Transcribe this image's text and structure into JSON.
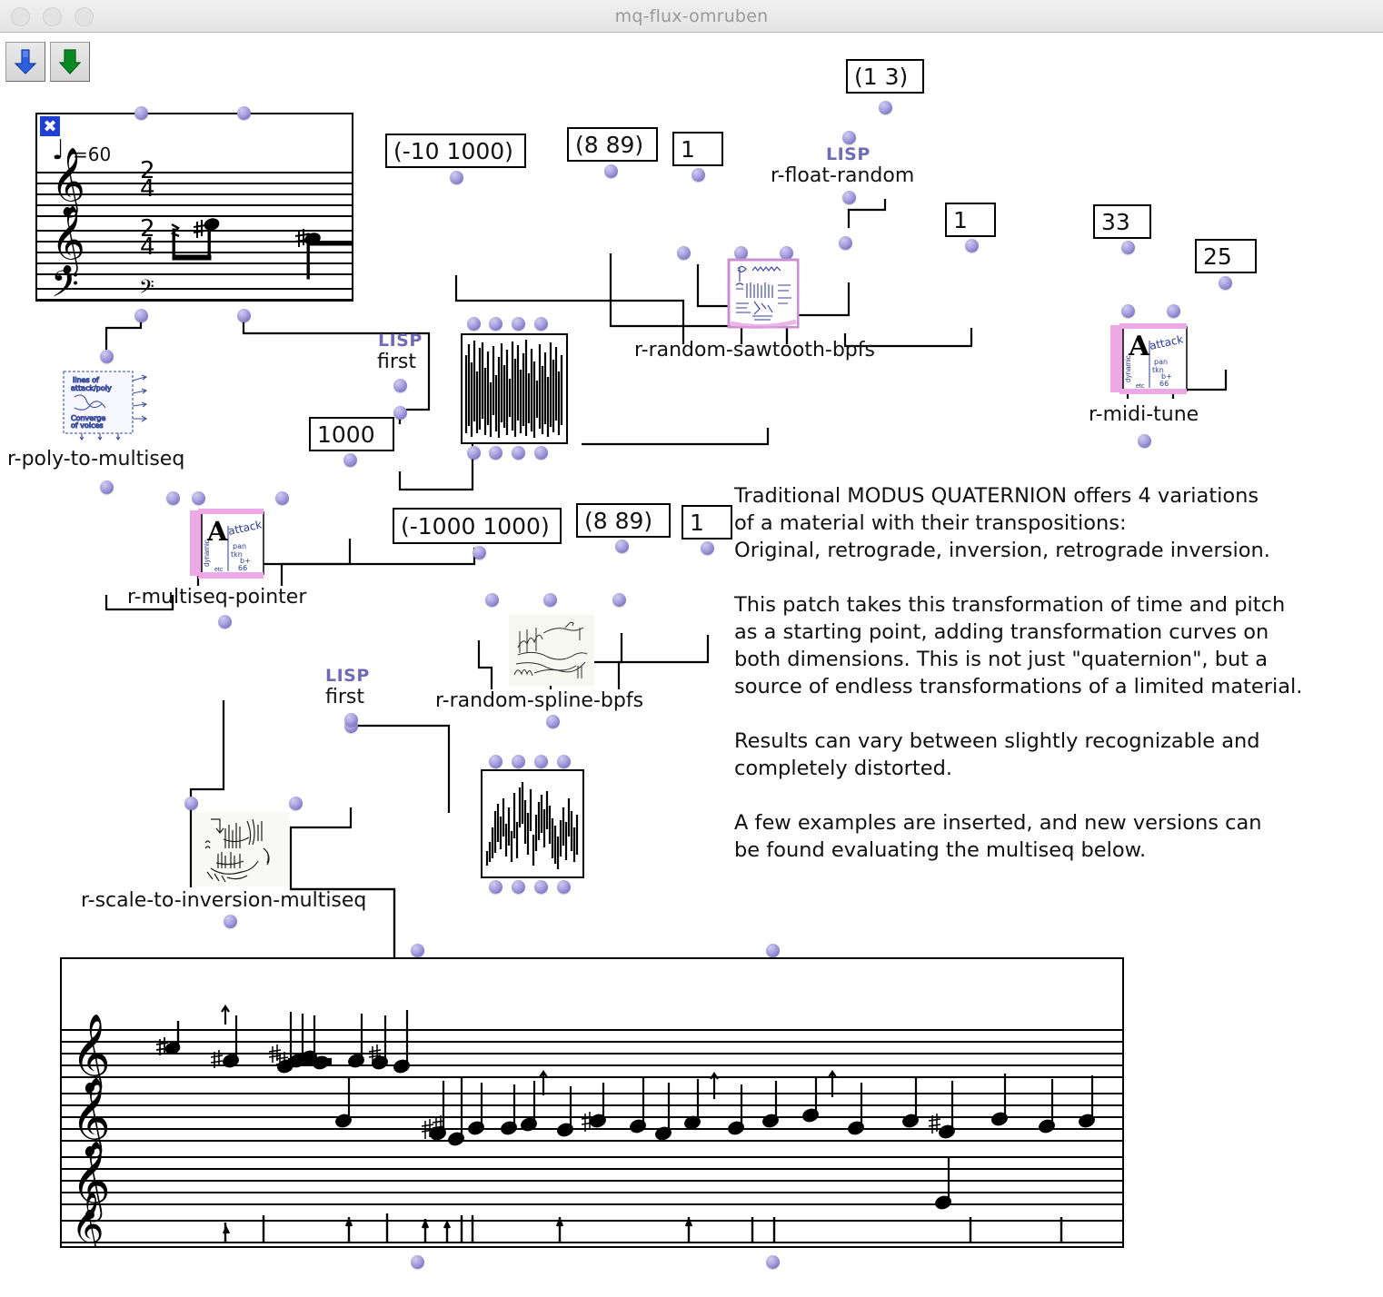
{
  "window": {
    "title": "mq-flux-omruben",
    "traffic_lights": [
      "close",
      "minimize",
      "zoom"
    ]
  },
  "toolbar": {
    "buttons": [
      {
        "name": "eval-down-blue",
        "icon": "down-arrow-blue-icon",
        "color": "#2b5fe0"
      },
      {
        "name": "eval-down-green",
        "icon": "down-arrow-green-icon",
        "color": "#0a8a22"
      }
    ]
  },
  "boxes": {
    "b_neg10_1000": "(-10 1000)",
    "b_8_89_top": "(8 89)",
    "b_1_top": "1",
    "b_1_3": "(1 3)",
    "b_1_right": "1",
    "b_33": "33",
    "b_25": "25",
    "b_1000": "1000",
    "b_neg1000_1000": "(-1000 1000)",
    "b_8_89_bottom": "(8 89)",
    "b_1_bottom": "1"
  },
  "nodes": {
    "float_random": {
      "lisp": "LISP",
      "label": "r-float-random"
    },
    "sawtooth": {
      "label": "r-random-sawtooth-bpfs"
    },
    "midi_tune": {
      "label": "r-midi-tune"
    },
    "poly_to_multiseq": {
      "label": "r-poly-to-multiseq"
    },
    "first_top": {
      "lisp": "LISP",
      "label": "first"
    },
    "multiseq_pointer": {
      "label": "r-multiseq-pointer"
    },
    "spline": {
      "label": "r-random-spline-bpfs"
    },
    "first_bottom": {
      "lisp": "LISP",
      "label": "first"
    },
    "scale_to_inversion": {
      "label": "r-scale-to-inversion-multiseq"
    }
  },
  "score_top": {
    "tempo_note": "♩",
    "tempo_text": "=60",
    "time_signature": {
      "numerator": "2",
      "denominator": "4"
    },
    "clefs": [
      "treble",
      "treble",
      "bass"
    ]
  },
  "score_bottom": {
    "clefs": [
      "treble",
      "treble",
      "treble",
      "treble"
    ]
  },
  "comment": {
    "paragraphs": [
      "Traditional MODUS QUATERNION offers 4 variations\nof a material with their transpositions:\nOriginal, retrograde, inversion, retrograde inversion.",
      "This patch takes this transformation of time and pitch\nas a starting point, adding transformation curves on\nboth dimensions. This is not just \"quaternion\", but a\nsource of endless transformations of a limited material.",
      "Results can vary between slightly recognizable and\ncompletely distorted.",
      "A few examples are inserted, and new versions can\nbe found evaluating the multiseq below."
    ]
  },
  "colors": {
    "port": "#8079c7",
    "lisp_text": "#6f6ab6",
    "wire": "#000000",
    "titlebar_text": "#9a9a9a",
    "tile_pink": "#e8a8e0",
    "tile_blue": "#3b4fa8"
  }
}
